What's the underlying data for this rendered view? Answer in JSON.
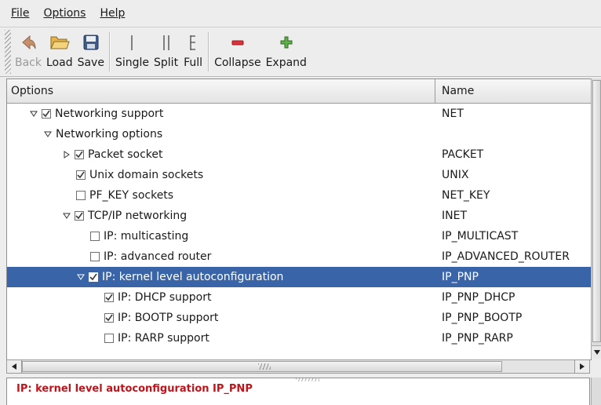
{
  "menubar": {
    "items": [
      {
        "label": "File"
      },
      {
        "label": "Options"
      },
      {
        "label": "Help"
      }
    ]
  },
  "toolbar": {
    "back_label": "Back",
    "load_label": "Load",
    "save_label": "Save",
    "single_label": "Single",
    "split_label": "Split",
    "full_label": "Full",
    "collapse_label": "Collapse",
    "expand_label": "Expand"
  },
  "tree": {
    "columns": [
      "Options",
      "Name"
    ],
    "rows": [
      {
        "label": "Networking support",
        "name": "NET",
        "checked": true
      },
      {
        "label": "Networking options",
        "name": ""
      },
      {
        "label": "Packet socket",
        "name": "PACKET",
        "checked": true
      },
      {
        "label": "Unix domain sockets",
        "name": "UNIX",
        "checked": true
      },
      {
        "label": "PF_KEY sockets",
        "name": "NET_KEY",
        "checked": false
      },
      {
        "label": "TCP/IP networking",
        "name": "INET",
        "checked": true
      },
      {
        "label": "IP: multicasting",
        "name": "IP_MULTICAST",
        "checked": false
      },
      {
        "label": "IP: advanced router",
        "name": "IP_ADVANCED_ROUTER",
        "checked": false
      },
      {
        "label": "IP: kernel level autoconfiguration",
        "name": "IP_PNP",
        "checked": true
      },
      {
        "label": "IP: DHCP support",
        "name": "IP_PNP_DHCP",
        "checked": true
      },
      {
        "label": "IP: BOOTP support",
        "name": "IP_PNP_BOOTP",
        "checked": true
      },
      {
        "label": "IP: RARP support",
        "name": "IP_PNP_RARP",
        "checked": false
      }
    ]
  },
  "help": {
    "message": "IP: kernel level autoconfiguration IP_PNP"
  },
  "colors": {
    "selection": "#3a64a8",
    "help_text": "#c0141b",
    "check": "#3b3b3b"
  }
}
